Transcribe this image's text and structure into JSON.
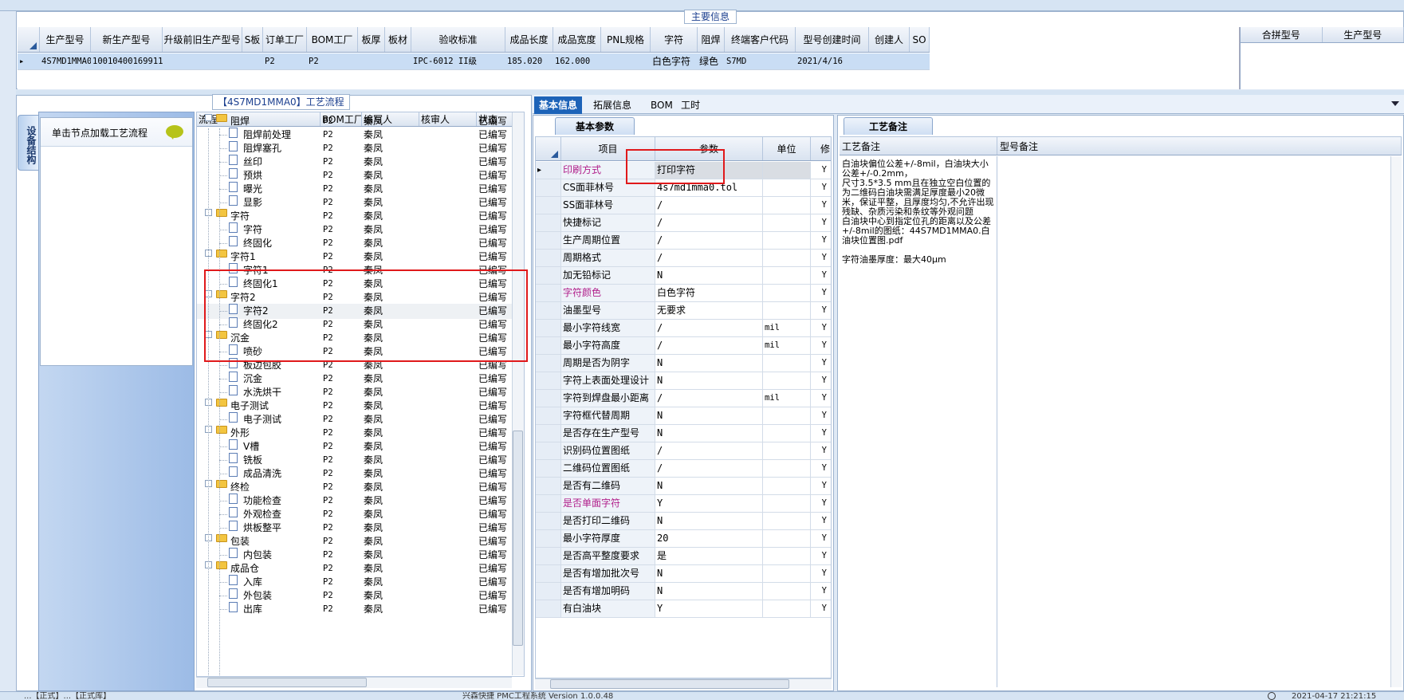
{
  "main_info": {
    "title": "主要信息",
    "columns": [
      "生产型号",
      "新生产型号",
      "升级前旧生产型号",
      "S板",
      "订单工厂",
      "BOM工厂",
      "板厚",
      "板材",
      "验收标准",
      "成品长度",
      "成品宽度",
      "PNL规格",
      "字符",
      "阻焊",
      "终端客户代码",
      "型号创建时间",
      "创建人",
      "SO"
    ],
    "row": [
      "4S7MD1MMA0",
      "10010400169911",
      "",
      "",
      "P2",
      "P2",
      "",
      "",
      "IPC-6012 II级",
      "185.020",
      "162.000",
      "",
      "白色字符",
      "绿色",
      "S7MD",
      "2021/4/16",
      "",
      ""
    ],
    "side_columns": [
      "合拼型号",
      "生产型号"
    ]
  },
  "process": {
    "title": "【4S7MD1MMA0】工艺流程",
    "vertical_tab": "设备结构",
    "nav_card_title": "单击节点加载工艺流程",
    "columns": [
      "流程",
      "BOM工厂",
      "编写人",
      "核审人",
      "状态"
    ],
    "rows": [
      {
        "label": "阻焊",
        "level": 0,
        "bom": "P2",
        "writer": "秦凤",
        "status": "已编写"
      },
      {
        "label": "阻焊前处理",
        "level": 1,
        "bom": "P2",
        "writer": "秦凤",
        "status": "已编写"
      },
      {
        "label": "阻焊塞孔",
        "level": 1,
        "bom": "P2",
        "writer": "秦凤",
        "status": "已编写"
      },
      {
        "label": "丝印",
        "level": 1,
        "bom": "P2",
        "writer": "秦凤",
        "status": "已编写"
      },
      {
        "label": "预烘",
        "level": 1,
        "bom": "P2",
        "writer": "秦凤",
        "status": "已编写"
      },
      {
        "label": "曝光",
        "level": 1,
        "bom": "P2",
        "writer": "秦凤",
        "status": "已编写"
      },
      {
        "label": "显影",
        "level": 1,
        "bom": "P2",
        "writer": "秦凤",
        "status": "已编写"
      },
      {
        "label": "字符",
        "level": 0,
        "bom": "P2",
        "writer": "秦凤",
        "status": "已编写"
      },
      {
        "label": "字符",
        "level": 1,
        "bom": "P2",
        "writer": "秦凤",
        "status": "已编写"
      },
      {
        "label": "终固化",
        "level": 1,
        "bom": "P2",
        "writer": "秦凤",
        "status": "已编写"
      },
      {
        "label": "字符1",
        "level": 0,
        "bom": "P2",
        "writer": "秦凤",
        "status": "已编写"
      },
      {
        "label": "字符1",
        "level": 1,
        "bom": "P2",
        "writer": "秦凤",
        "status": "已编写"
      },
      {
        "label": "终固化1",
        "level": 1,
        "bom": "P2",
        "writer": "秦凤",
        "status": "已编写"
      },
      {
        "label": "字符2",
        "level": 0,
        "bom": "P2",
        "writer": "秦凤",
        "status": "已编写"
      },
      {
        "label": "字符2",
        "level": 1,
        "bom": "P2",
        "writer": "秦凤",
        "status": "已编写",
        "selected": true
      },
      {
        "label": "终固化2",
        "level": 1,
        "bom": "P2",
        "writer": "秦凤",
        "status": "已编写"
      },
      {
        "label": "沉金",
        "level": 0,
        "bom": "P2",
        "writer": "秦凤",
        "status": "已编写"
      },
      {
        "label": "喷砂",
        "level": 1,
        "bom": "P2",
        "writer": "秦凤",
        "status": "已编写"
      },
      {
        "label": "板边包胶",
        "level": 1,
        "bom": "P2",
        "writer": "秦凤",
        "status": "已编写"
      },
      {
        "label": "沉金",
        "level": 1,
        "bom": "P2",
        "writer": "秦凤",
        "status": "已编写"
      },
      {
        "label": "水洗烘干",
        "level": 1,
        "bom": "P2",
        "writer": "秦凤",
        "status": "已编写"
      },
      {
        "label": "电子测试",
        "level": 0,
        "bom": "P2",
        "writer": "秦凤",
        "status": "已编写"
      },
      {
        "label": "电子测试",
        "level": 1,
        "bom": "P2",
        "writer": "秦凤",
        "status": "已编写"
      },
      {
        "label": "外形",
        "level": 0,
        "bom": "P2",
        "writer": "秦凤",
        "status": "已编写"
      },
      {
        "label": "V槽",
        "level": 1,
        "bom": "P2",
        "writer": "秦凤",
        "status": "已编写"
      },
      {
        "label": "铣板",
        "level": 1,
        "bom": "P2",
        "writer": "秦凤",
        "status": "已编写"
      },
      {
        "label": "成品清洗",
        "level": 1,
        "bom": "P2",
        "writer": "秦凤",
        "status": "已编写"
      },
      {
        "label": "终检",
        "level": 0,
        "bom": "P2",
        "writer": "秦凤",
        "status": "已编写"
      },
      {
        "label": "功能检查",
        "level": 1,
        "bom": "P2",
        "writer": "秦凤",
        "status": "已编写"
      },
      {
        "label": "外观检查",
        "level": 1,
        "bom": "P2",
        "writer": "秦凤",
        "status": "已编写"
      },
      {
        "label": "烘板整平",
        "level": 1,
        "bom": "P2",
        "writer": "秦凤",
        "status": "已编写"
      },
      {
        "label": "包装",
        "level": 0,
        "bom": "P2",
        "writer": "秦凤",
        "status": "已编写"
      },
      {
        "label": "内包装",
        "level": 1,
        "bom": "P2",
        "writer": "秦凤",
        "status": "已编写"
      },
      {
        "label": "成品仓",
        "level": 0,
        "bom": "P2",
        "writer": "秦凤",
        "status": "已编写"
      },
      {
        "label": "入库",
        "level": 1,
        "bom": "P2",
        "writer": "秦凤",
        "status": "已编写"
      },
      {
        "label": "外包装",
        "level": 1,
        "bom": "P2",
        "writer": "秦凤",
        "status": "已编写"
      },
      {
        "label": "出库",
        "level": 1,
        "bom": "P2",
        "writer": "秦凤",
        "status": "已编写"
      }
    ]
  },
  "tabs": [
    "基本信息",
    "拓展信息",
    "BOM",
    "工时"
  ],
  "basic_params": {
    "sub_tab": "基本参数",
    "columns": [
      "项目",
      "参数",
      "单位",
      "修"
    ],
    "rows": [
      {
        "item": "印刷方式",
        "value": "打印字符",
        "unit": "",
        "flag": "Y",
        "hl": true,
        "mono": false
      },
      {
        "item": "CS面菲林号",
        "value": "4s7md1mma0.tol",
        "unit": "",
        "flag": "Y",
        "hl": false,
        "mono": true
      },
      {
        "item": "SS面菲林号",
        "value": "/",
        "unit": "",
        "flag": "Y",
        "hl": false,
        "mono": true
      },
      {
        "item": "快捷标记",
        "value": "/",
        "unit": "",
        "flag": "Y",
        "hl": false,
        "mono": true
      },
      {
        "item": "生产周期位置",
        "value": "/",
        "unit": "",
        "flag": "Y",
        "hl": false,
        "mono": true
      },
      {
        "item": "周期格式",
        "value": "/",
        "unit": "",
        "flag": "Y",
        "hl": false,
        "mono": true
      },
      {
        "item": "加无铅标记",
        "value": "N",
        "unit": "",
        "flag": "Y",
        "hl": false,
        "mono": true
      },
      {
        "item": "字符颜色",
        "value": "白色字符",
        "unit": "",
        "flag": "Y",
        "hl": true,
        "mono": false
      },
      {
        "item": "油墨型号",
        "value": "无要求",
        "unit": "",
        "flag": "Y",
        "hl": false,
        "mono": false
      },
      {
        "item": "最小字符线宽",
        "value": "/",
        "unit": "mil",
        "flag": "Y",
        "hl": false,
        "mono": true
      },
      {
        "item": "最小字符高度",
        "value": "/",
        "unit": "mil",
        "flag": "Y",
        "hl": false,
        "mono": true
      },
      {
        "item": "周期是否为阴字",
        "value": "N",
        "unit": "",
        "flag": "Y",
        "hl": false,
        "mono": true
      },
      {
        "item": "字符上表面处理设计",
        "value": "N",
        "unit": "",
        "flag": "Y",
        "hl": false,
        "mono": true
      },
      {
        "item": "字符到焊盘最小距离",
        "value": "/",
        "unit": "mil",
        "flag": "Y",
        "hl": false,
        "mono": true
      },
      {
        "item": "字符框代替周期",
        "value": "N",
        "unit": "",
        "flag": "Y",
        "hl": false,
        "mono": true
      },
      {
        "item": "是否存在生产型号",
        "value": "N",
        "unit": "",
        "flag": "Y",
        "hl": false,
        "mono": true
      },
      {
        "item": "识别码位置图纸",
        "value": "/",
        "unit": "",
        "flag": "Y",
        "hl": false,
        "mono": true
      },
      {
        "item": "二维码位置图纸",
        "value": "/",
        "unit": "",
        "flag": "Y",
        "hl": false,
        "mono": true
      },
      {
        "item": "是否有二维码",
        "value": "N",
        "unit": "",
        "flag": "Y",
        "hl": false,
        "mono": true
      },
      {
        "item": "是否单面字符",
        "value": "Y",
        "unit": "",
        "flag": "Y",
        "hl": true,
        "mono": true
      },
      {
        "item": "是否打印二维码",
        "value": "N",
        "unit": "",
        "flag": "Y",
        "hl": false,
        "mono": true
      },
      {
        "item": "最小字符厚度",
        "value": "20",
        "unit": "",
        "flag": "Y",
        "hl": false,
        "mono": true
      },
      {
        "item": "是否高平整度要求",
        "value": "是",
        "unit": "",
        "flag": "Y",
        "hl": false,
        "mono": false
      },
      {
        "item": "是否有增加批次号",
        "value": "N",
        "unit": "",
        "flag": "Y",
        "hl": false,
        "mono": true
      },
      {
        "item": "是否有增加明码",
        "value": "N",
        "unit": "",
        "flag": "Y",
        "hl": false,
        "mono": true
      },
      {
        "item": "有白油块",
        "value": "Y",
        "unit": "",
        "flag": "Y",
        "hl": false,
        "mono": true
      }
    ]
  },
  "notes": {
    "tab": "工艺备注",
    "columns": [
      "工艺备注",
      "型号备注"
    ],
    "process_note": "白油块偏位公差+/-8mil，白油块大小公差+/-0.2mm，\n尺寸3.5*3.5 mm且在独立空白位置的为二维码白油块需满足厚度最小20微米，保证平整，且厚度均匀,不允许出现残缺、杂质污染和条纹等外观问题\n白油块中心到指定位孔的距离以及公差+/-8mil的图纸：44S7MD1MMA0.白油块位置图.pdf\n\n字符油墨厚度：最大40μm"
  },
  "status_bar": {
    "left": "...【正式】...【正式库】",
    "center": "兴森快捷 PMC工程系统 Version 1.0.0.48",
    "right": "2021-04-17 21:21:15"
  }
}
